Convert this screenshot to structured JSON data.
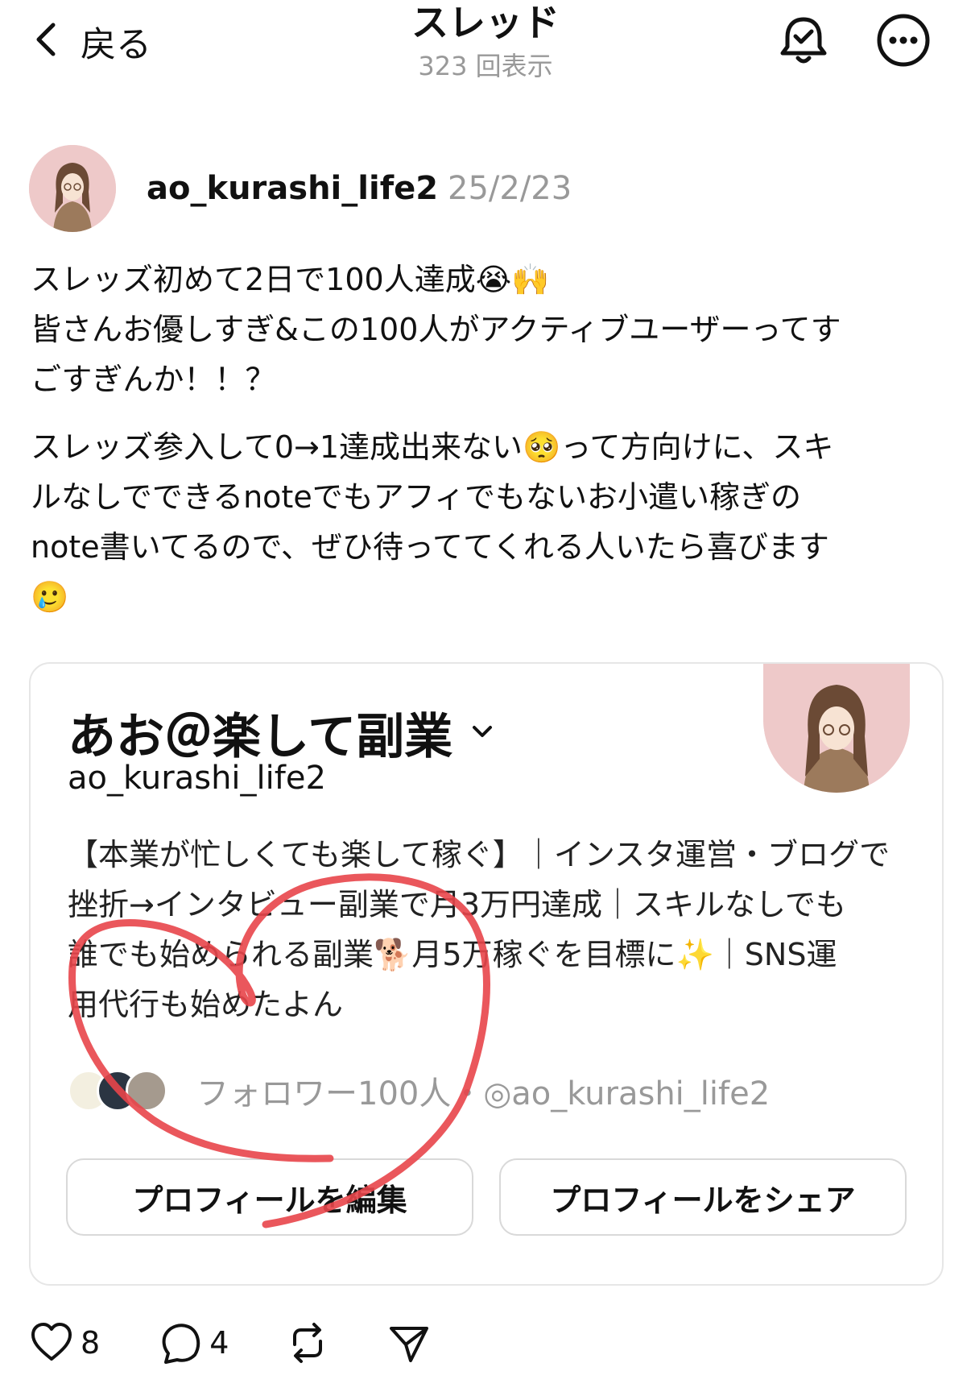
{
  "header": {
    "back_label": "戻る",
    "title": "スレッド",
    "views": "323 回表示"
  },
  "post": {
    "username": "ao_kurashi_life2",
    "date": "25/2/23",
    "paragraphs": [
      "スレッズ初めて2日で100人達成😭🙌\n皆さんお優しすぎ&この100人がアクティブユーザーってす\nごすぎんか！！？",
      "スレッズ参入して0→1達成出来ない🥺って方向けに、スキ\nルなしでできるnoteでもアフィでもないお小遣い稼ぎの\nnote書いてるので、ぜひ待っててくれる人いたら喜びます\n🥲"
    ]
  },
  "profile_card": {
    "name": "あお＠楽して副業",
    "handle": "ao_kurashi_life2",
    "bio_lines": [
      "【本業が忙しくても楽して稼ぐ】｜インスタ運営・ブログで",
      "挫折→インタビュー副業で月3万円達成｜スキルなしでも",
      "誰でも始められる副業🐕月5万稼ぐを目標に✨｜SNS運",
      "用代行も始めたよん"
    ],
    "followers_text": "フォロワー100人・◎ao_kurashi_life2",
    "edit_button": "プロフィールを編集",
    "share_button": "プロフィールをシェア"
  },
  "actions": {
    "likes": "8",
    "replies": "4"
  },
  "colors": {
    "scribble": "#e8454a",
    "avatar_bg": "#eec9c9",
    "muted_text": "#999999"
  },
  "icons": [
    "chevron-left-icon",
    "bell-check-icon",
    "more-icon",
    "chevron-down-icon",
    "heart-icon",
    "comment-icon",
    "repost-icon",
    "send-icon"
  ]
}
